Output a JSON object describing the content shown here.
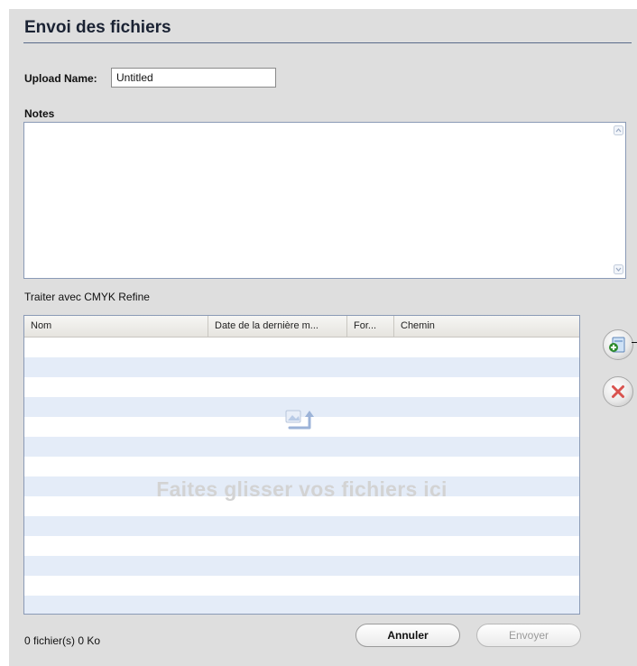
{
  "dialog": {
    "title": "Envoi des fichiers",
    "upload_name_label": "Upload Name:",
    "upload_name_value": "Untitled",
    "notes_label": "Notes",
    "notes_value": "",
    "process_label": "Traiter avec  CMYK Refine"
  },
  "table": {
    "columns": [
      "Nom",
      "Date de la dernière m...",
      "For...",
      "Chemin"
    ],
    "rows": [],
    "drop_hint": "Faites glisser vos fichiers ici"
  },
  "icons": {
    "add": "add-file-icon",
    "remove": "remove-icon",
    "drop": "upload-files-icon",
    "scroll_up": "scroll-up-arrow-icon",
    "scroll_down": "scroll-down-arrow-icon"
  },
  "footer": {
    "status": "0 fichier(s) 0 Ko",
    "cancel_label": "Annuler",
    "send_label": "Envoyer",
    "send_enabled": false
  },
  "colors": {
    "panel_bg": "#dedede",
    "row_stripe": "#e4ecf8",
    "title_rule": "#5a6a8a",
    "remove_red": "#d9534f",
    "add_green": "#2e8b2e"
  }
}
